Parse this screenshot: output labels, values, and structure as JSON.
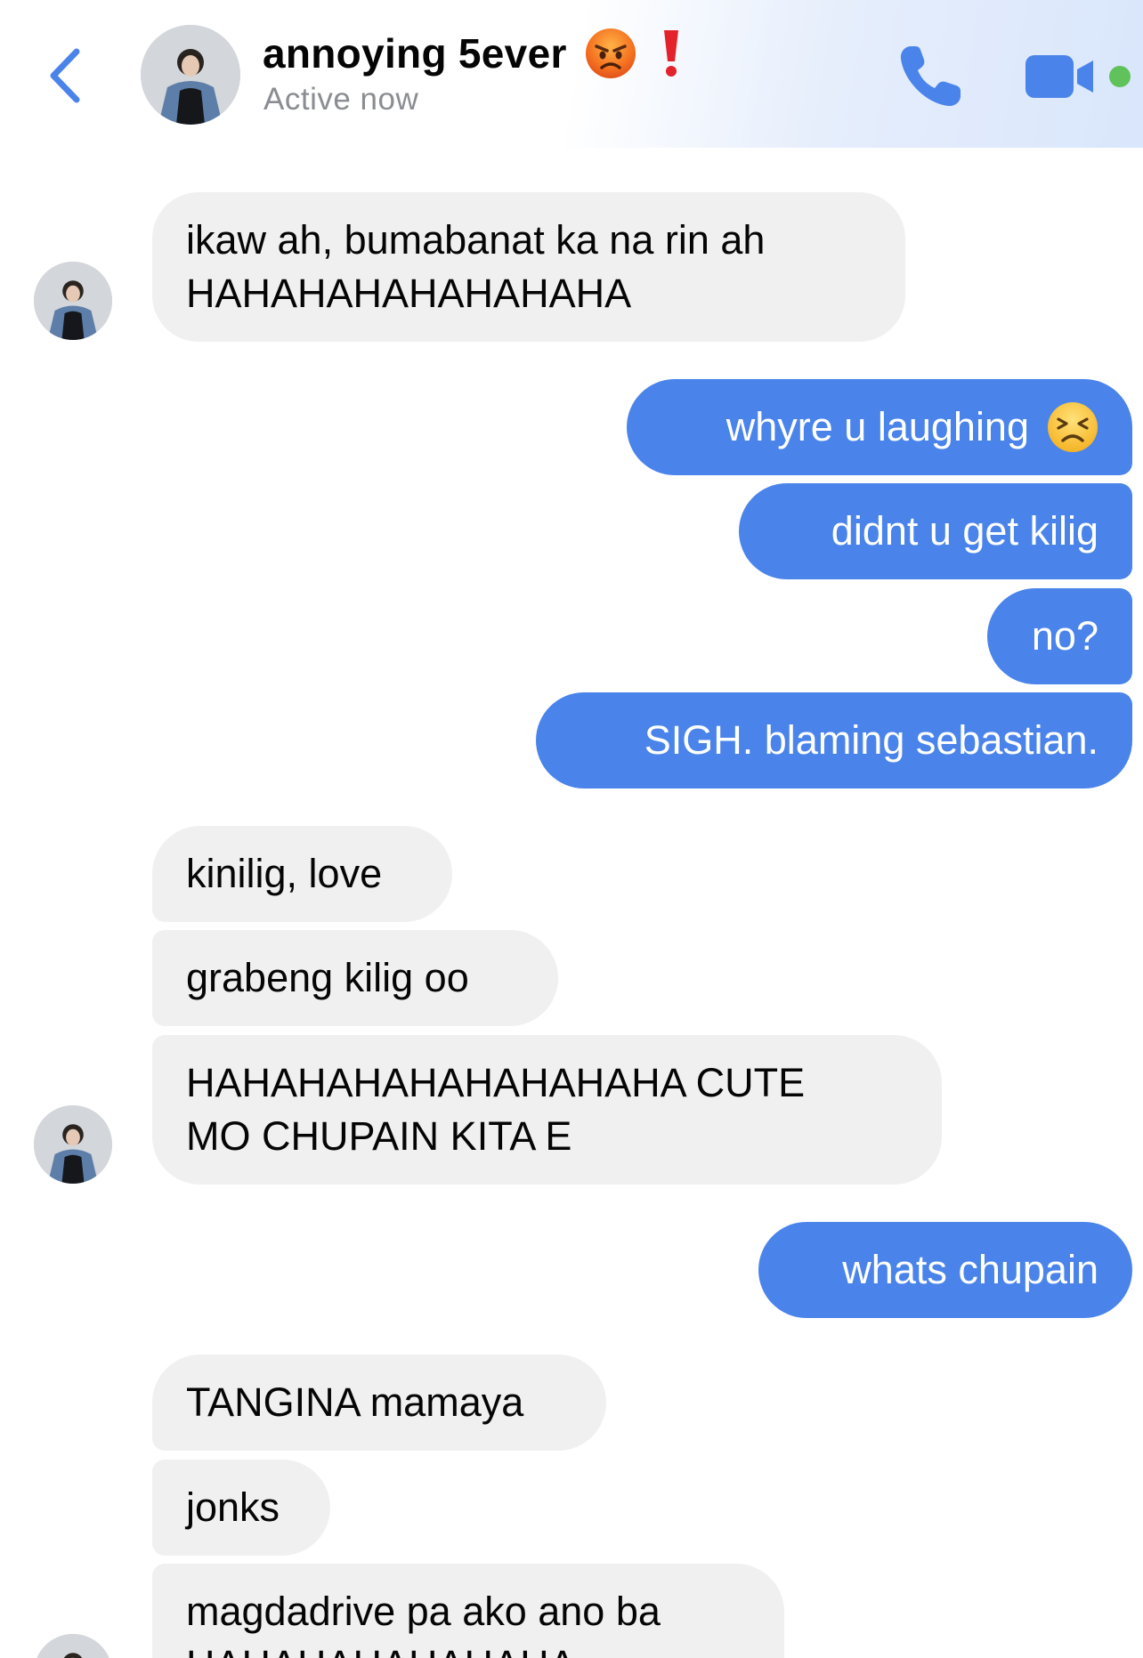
{
  "header": {
    "title": "annoying 5ever",
    "status": "Active now",
    "icons": [
      "back-chevron-icon",
      "angry-face-emoji",
      "red-exclamation-emoji",
      "phone-icon",
      "video-camera-icon"
    ],
    "online_color": "#60c25a",
    "accent_color": "#4a84ea"
  },
  "messages": [
    {
      "side": "in",
      "lines": [
        "ikaw ah, bumabanat ka na rin ah",
        "HAHAHAHAHAHAHAHA"
      ]
    },
    {
      "side": "out",
      "text": "whyre u laughing",
      "emoji": "tired-face-emoji"
    },
    {
      "side": "out",
      "text": "didnt u get kilig"
    },
    {
      "side": "out",
      "text": "no?"
    },
    {
      "side": "out",
      "text": "SIGH. blaming sebastian."
    },
    {
      "side": "in",
      "text": "kinilig, love"
    },
    {
      "side": "in",
      "text": "grabeng kilig oo"
    },
    {
      "side": "in",
      "lines": [
        "HAHAHAHAHAHAHAHAHA CUTE",
        "MO CHUPAIN KITA E"
      ]
    },
    {
      "side": "out",
      "text": "whats chupain"
    },
    {
      "side": "in",
      "text": "TANGINA mamaya"
    },
    {
      "side": "in",
      "text": "jonks"
    },
    {
      "side": "in",
      "lines": [
        "magdadrive pa ako ano ba",
        "HAHAHAHAHAHAHA"
      ]
    }
  ],
  "colors": {
    "incoming_bubble": "#f0f0f0",
    "outgoing_bubble": "#4a84ea",
    "outgoing_text": "#ffffff"
  }
}
